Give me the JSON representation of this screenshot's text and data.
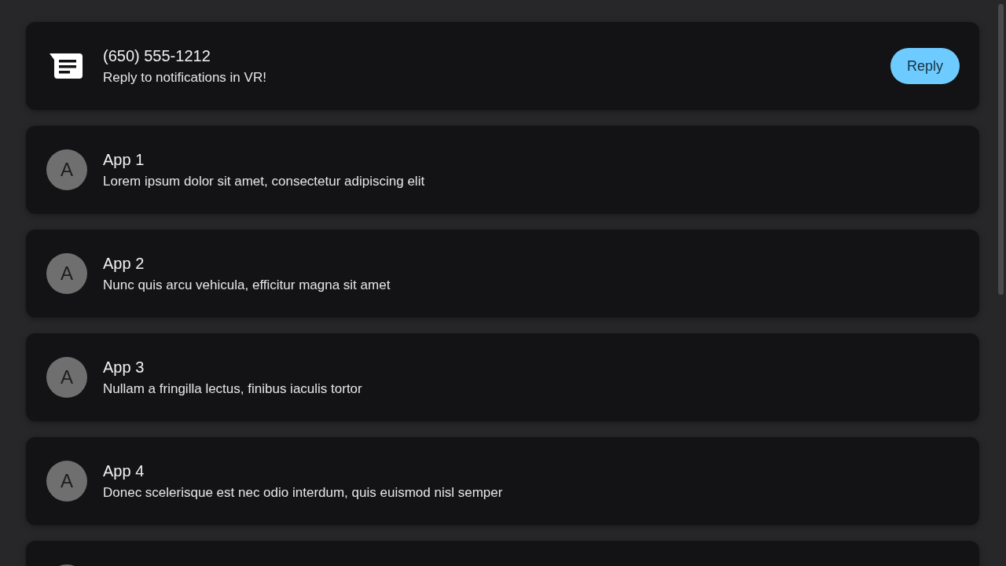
{
  "notifications": [
    {
      "kind": "message",
      "title": "(650) 555-1212",
      "text": "Reply to notifications in VR!",
      "action": "Reply"
    },
    {
      "kind": "app",
      "avatar": "A",
      "title": "App 1",
      "text": "Lorem ipsum dolor sit amet, consectetur adipiscing elit"
    },
    {
      "kind": "app",
      "avatar": "A",
      "title": "App 2",
      "text": "Nunc quis arcu vehicula, efficitur magna sit amet"
    },
    {
      "kind": "app",
      "avatar": "A",
      "title": "App 3",
      "text": "Nullam a fringilla lectus, finibus iaculis tortor"
    },
    {
      "kind": "app",
      "avatar": "A",
      "title": "App 4",
      "text": "Donec scelerisque est nec odio interdum, quis euismod nisl semper"
    },
    {
      "kind": "cut_off"
    }
  ]
}
